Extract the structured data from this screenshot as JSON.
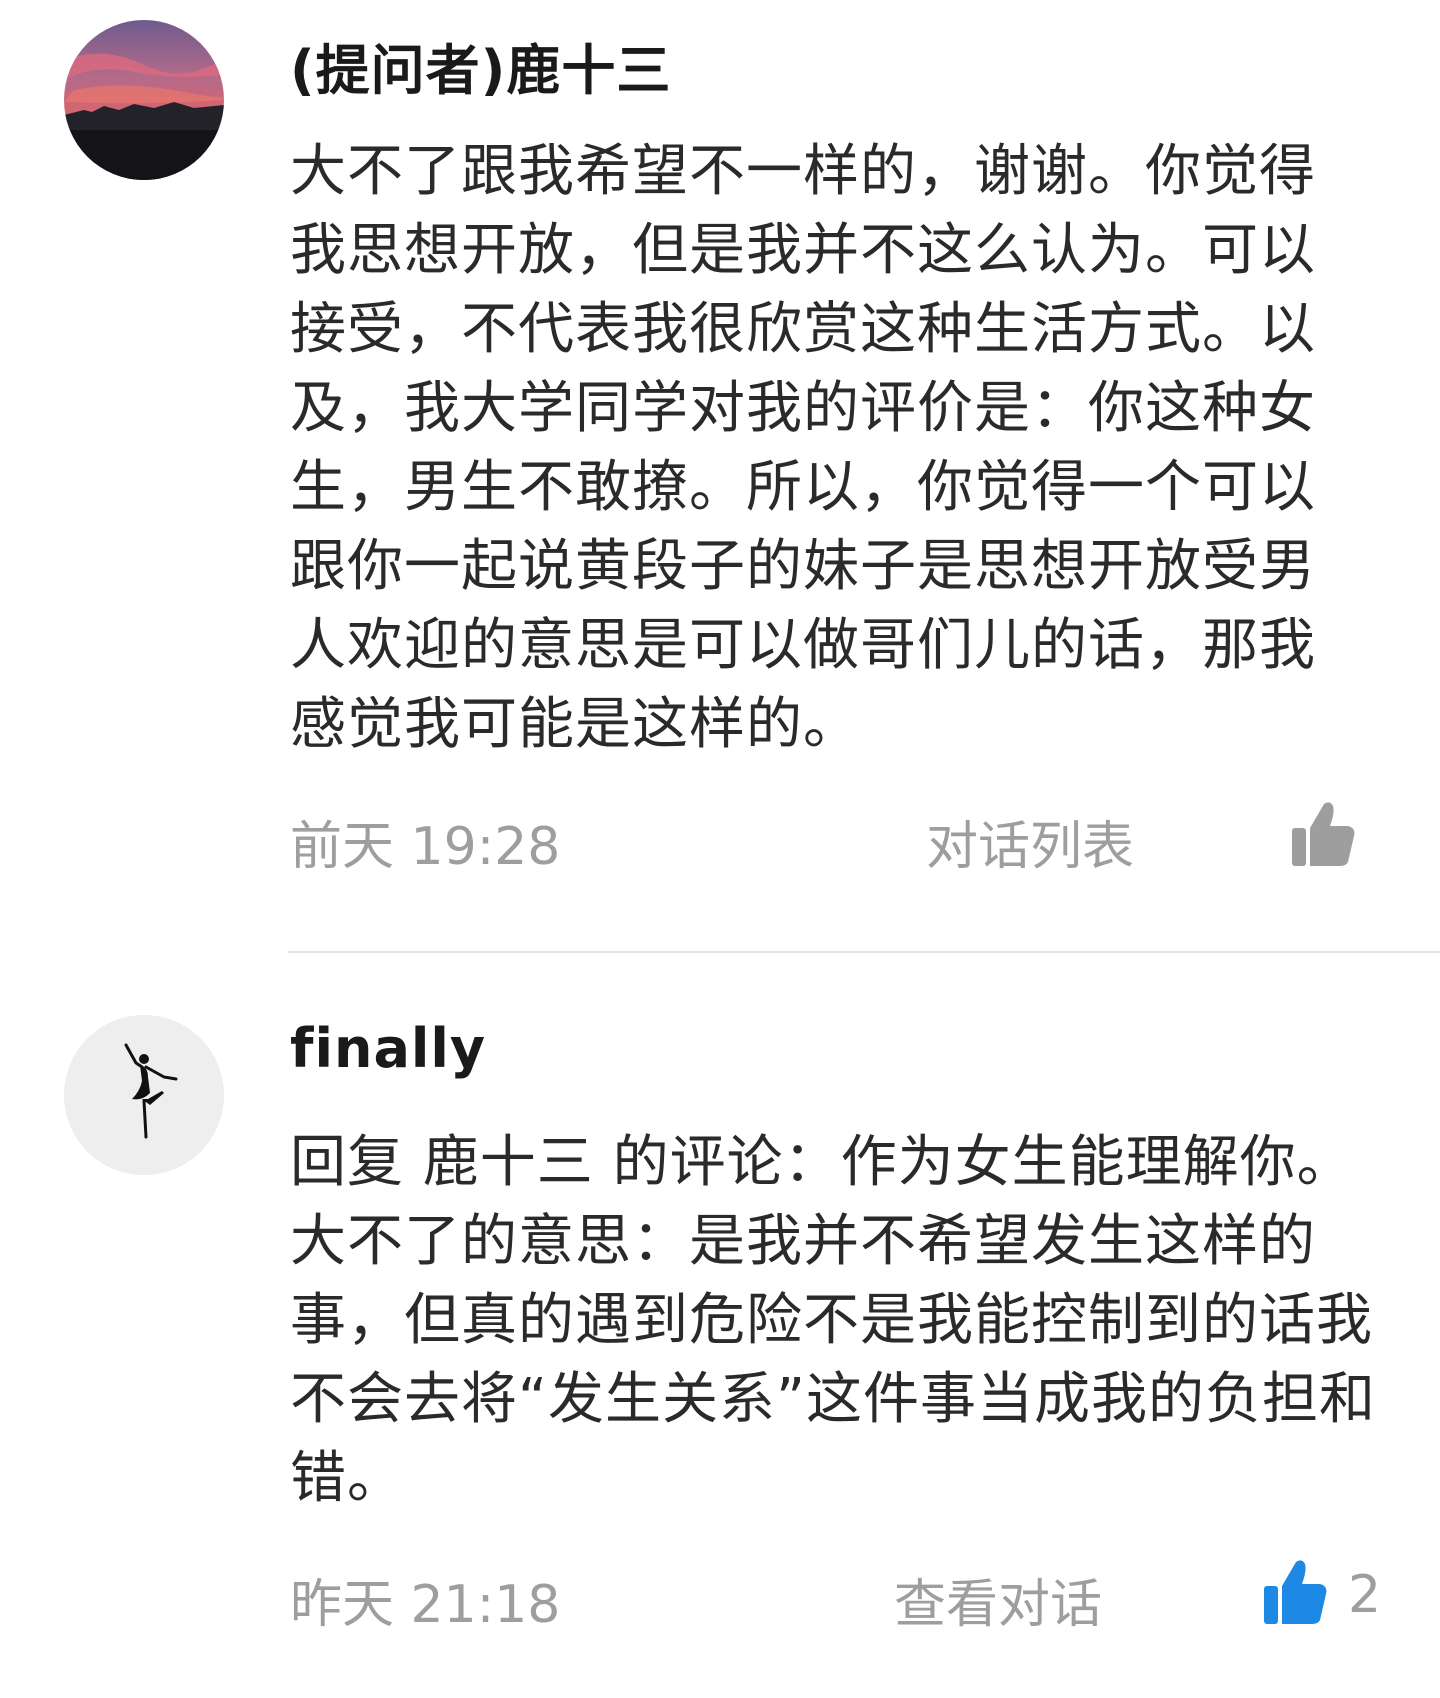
{
  "comments": [
    {
      "author": "(提问者)鹿十三",
      "body": "大不了跟我希望不一样的，谢谢。你觉得我思想开放，但是我并不这么认为。可以接受，不代表我很欣赏这种生活方式。以及，我大学同学对我的评价是：你这种女生，男生不敢撩。所以，你觉得一个可以跟你一起说黄段子的妹子是思想开放受男人欢迎的意思是可以做哥们儿的话，那我感觉我可能是这样的。",
      "time": "前天 19:28",
      "action": "对话列表",
      "like_icon": "thumbs-up-icon",
      "like_color": "#9e9e9e",
      "like_count": ""
    },
    {
      "author": "finally",
      "body": "回复 鹿十三 的评论：作为女生能理解你。大不了的意思：是我并不希望发生这样的事，但真的遇到危险不是我能控制到的话我不会去将“发生关系”这件事当成我的负担和错。",
      "time": "昨天 21:18",
      "action": "查看对话",
      "like_icon": "thumbs-up-icon",
      "like_color": "#1e88e5",
      "like_count": "2"
    }
  ]
}
